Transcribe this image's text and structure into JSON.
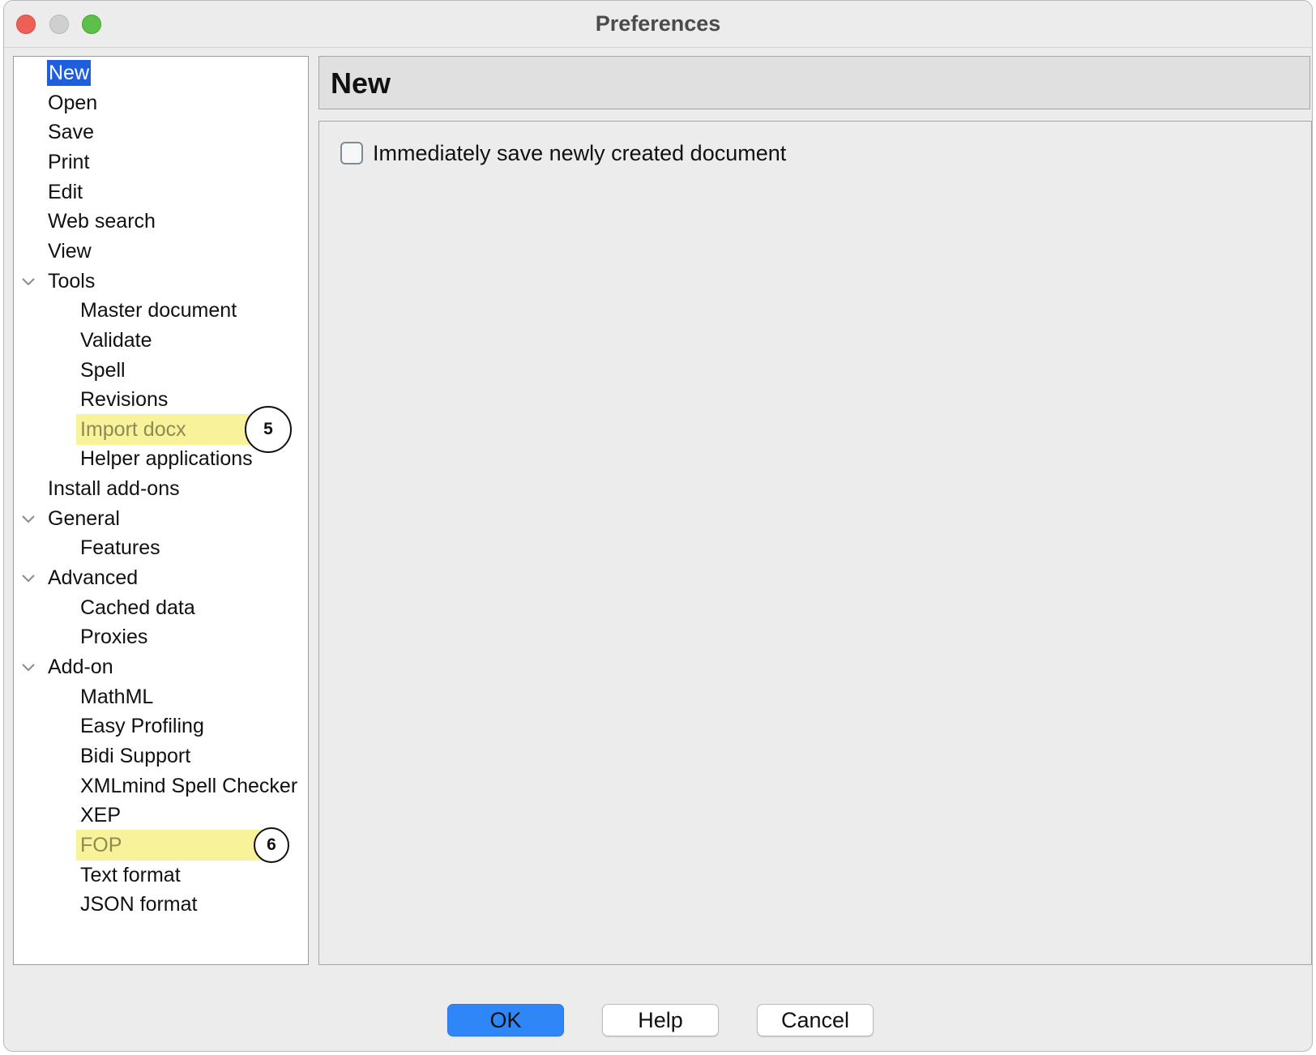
{
  "window": {
    "title": "Preferences"
  },
  "tree": {
    "items": [
      {
        "label": "New",
        "level": 0,
        "selected": true
      },
      {
        "label": "Open",
        "level": 0
      },
      {
        "label": "Save",
        "level": 0
      },
      {
        "label": "Print",
        "level": 0
      },
      {
        "label": "Edit",
        "level": 0
      },
      {
        "label": "Web search",
        "level": 0
      },
      {
        "label": "View",
        "level": 0
      },
      {
        "label": "Tools",
        "level": 0,
        "expanded": true
      },
      {
        "label": "Master document",
        "level": 1
      },
      {
        "label": "Validate",
        "level": 1
      },
      {
        "label": "Spell",
        "level": 1
      },
      {
        "label": "Revisions",
        "level": 1
      },
      {
        "label": "Import docx",
        "level": 1,
        "highlighted": true,
        "callout": "5"
      },
      {
        "label": "Helper applications",
        "level": 1
      },
      {
        "label": "Install add-ons",
        "level": 0
      },
      {
        "label": "General",
        "level": 0,
        "expanded": true
      },
      {
        "label": "Features",
        "level": 1
      },
      {
        "label": "Advanced",
        "level": 0,
        "expanded": true
      },
      {
        "label": "Cached data",
        "level": 1
      },
      {
        "label": "Proxies",
        "level": 1
      },
      {
        "label": "Add-on",
        "level": 0,
        "expanded": true
      },
      {
        "label": "MathML",
        "level": 1
      },
      {
        "label": "Easy Profiling",
        "level": 1
      },
      {
        "label": "Bidi Support",
        "level": 1
      },
      {
        "label": "XMLmind Spell Checker",
        "level": 1
      },
      {
        "label": "XEP",
        "level": 1
      },
      {
        "label": "FOP",
        "level": 1,
        "highlighted": true,
        "callout": "6"
      },
      {
        "label": "Text format",
        "level": 1
      },
      {
        "label": "JSON format",
        "level": 1
      }
    ]
  },
  "panel": {
    "title": "New",
    "checkbox_label": "Immediately save newly created document",
    "checkbox_checked": false
  },
  "buttons": {
    "ok": "OK",
    "help": "Help",
    "cancel": "Cancel"
  },
  "colors": {
    "selection": "#1f5fde",
    "highlight": "#f8f39a",
    "primary_button": "#2f86f6"
  }
}
